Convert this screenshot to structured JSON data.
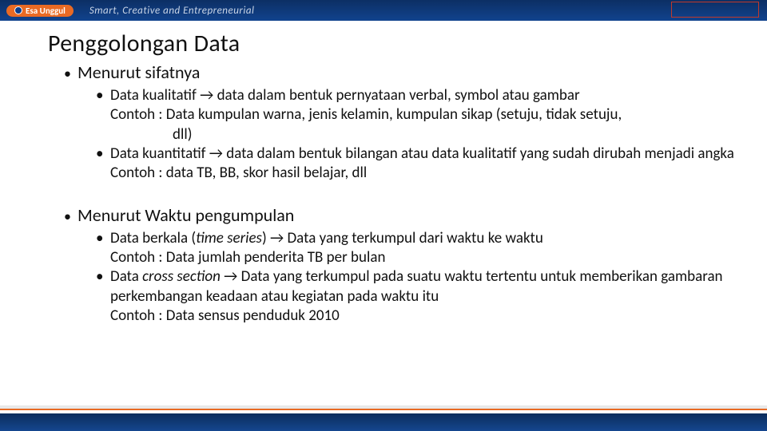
{
  "brand": {
    "name": "Esa Unggul",
    "tagline": "Smart, Creative and Entrepreneurial"
  },
  "title": "Penggolongan Data",
  "sections": [
    {
      "heading": "Menurut sifatnya",
      "items": [
        {
          "lead": "Data kualitatif → data dalam bentuk pernyataan verbal, symbol atau gambar",
          "extra": "Contoh : Data kumpulan warna, jenis kelamin, kumpulan sikap (setuju, tidak setuju,",
          "extra2": "dll)"
        },
        {
          "lead": "Data kuantitatif → data dalam bentuk bilangan atau data kualitatif yang sudah dirubah menjadi angka",
          "extra": "Contoh : data TB, BB, skor hasil belajar, dll"
        }
      ]
    },
    {
      "heading": "Menurut Waktu pengumpulan",
      "items": [
        {
          "lead_pre": "Data berkala (",
          "lead_ital": "time series",
          "lead_post": ") → Data yang terkumpul dari waktu ke waktu",
          "extra": "Contoh : Data jumlah penderita TB per bulan"
        },
        {
          "lead_pre": "Data ",
          "lead_ital": "cross section",
          "lead_post": "  → Data yang terkumpul pada suatu waktu tertentu untuk memberikan gambaran perkembangan keadaan  atau kegiatan pada waktu itu",
          "extra": "Contoh : Data sensus penduduk 2010"
        }
      ]
    }
  ]
}
